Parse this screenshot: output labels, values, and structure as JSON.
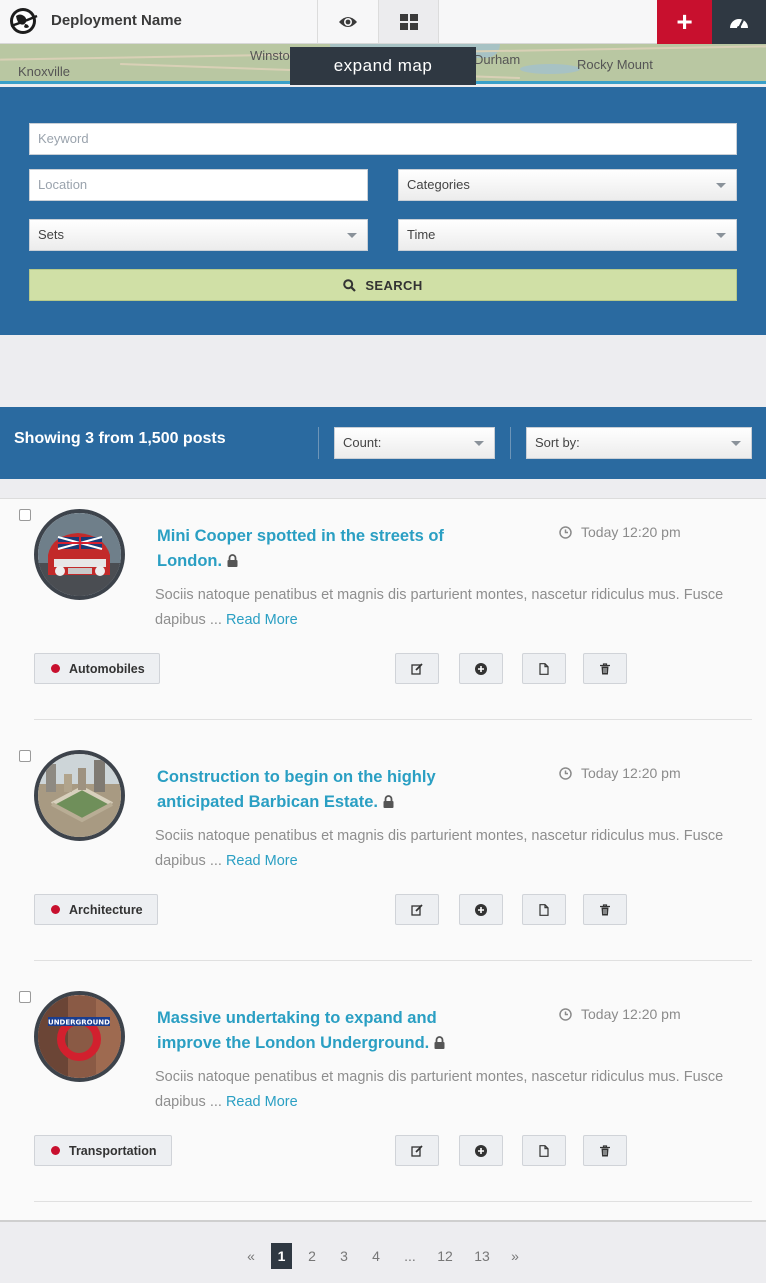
{
  "header": {
    "deployment_name": "Deployment Name",
    "logo_icon": "globe-logo-icon",
    "view_map_icon": "eye-icon",
    "view_list_icon": "grid-icon",
    "add_label": "+",
    "dashboard_icon": "dashboard-gauge-icon",
    "accent_color": "#c8102e"
  },
  "map": {
    "cities": [
      "Knoxville",
      "Winston",
      "Durham",
      "Rocky Mount"
    ],
    "expand_label": "expand map"
  },
  "filters": {
    "keyword_placeholder": "Keyword",
    "location_placeholder": "Location",
    "categories_label": "Categories",
    "sets_label": "Sets",
    "time_label": "Time",
    "search_label": "SEARCH"
  },
  "results": {
    "showing_text": "Showing 3 from 1,500 posts",
    "count_label": "Count:",
    "sort_label": "Sort by:"
  },
  "posts": [
    {
      "title": "Mini Cooper spotted in the streets of London.",
      "time": "Today 12:20 pm",
      "excerpt": "Sociis natoque penatibus et magnis dis parturient montes, nascetur ridiculus mus. Fusce dapibus ...",
      "read_more": "Read More",
      "category": "Automobiles",
      "thumb": "mini-cooper-photo"
    },
    {
      "title": "Construction to begin on the highly anticipated Barbican Estate.",
      "time": "Today 12:20 pm",
      "excerpt": "Sociis natoque penatibus et magnis dis parturient montes, nascetur ridiculus mus. Fusce dapibus ...",
      "read_more": "Read More",
      "category": "Architecture",
      "thumb": "barbican-aerial-photo"
    },
    {
      "title": "Massive undertaking to expand and improve the London Underground.",
      "time": "Today 12:20 pm",
      "excerpt": "Sociis natoque penatibus et magnis dis parturient montes, nascetur ridiculus mus. Fusce dapibus ...",
      "read_more": "Read More",
      "category": "Transportation",
      "thumb": "underground-sign-photo",
      "thumb_sign_text": "UNDERGROUND"
    }
  ],
  "post_actions": [
    "edit-icon",
    "add-circle-icon",
    "document-icon",
    "trash-icon"
  ],
  "pagination": {
    "prev": "«",
    "pages": [
      "1",
      "2",
      "3",
      "4",
      "...",
      "12",
      "13"
    ],
    "current": "1",
    "next": "»"
  }
}
